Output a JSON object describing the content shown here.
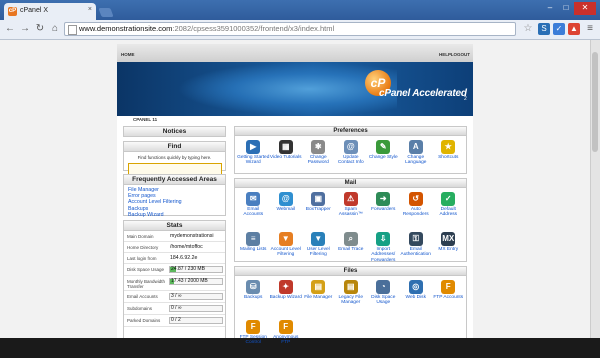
{
  "browser": {
    "tab_title": "cPanel X",
    "tab_favicon": "cP",
    "url_host": "www.demonstrationsite.com",
    "url_path": ":2082/cpsess3591000352/frontend/x3/index.html",
    "winbtn_min": "–",
    "winbtn_max": "□",
    "winbtn_close": "✕",
    "tab_close": "×"
  },
  "header": {
    "home": "HOME",
    "help": "HELP",
    "logout": "LOGOUT",
    "brand": "cPanel Accelerated",
    "brand_logo": "cP",
    "version": "2",
    "crumb": "CPANEL 11"
  },
  "notices": {
    "title": "Notices"
  },
  "find": {
    "title": "Find",
    "hint": "Find functions quickly by typing here."
  },
  "frequent": {
    "title": "Frequently Accessed Areas",
    "items": [
      "File Manager",
      "Error pages",
      "Account Level Filtering",
      "Backups",
      "Backup Wizard"
    ]
  },
  "stats": {
    "title": "Stats",
    "rows": [
      {
        "k": "Main Domain",
        "v": "mydemonstrationsi"
      },
      {
        "k": "Home Directory",
        "v": "/home/mtoffoc"
      },
      {
        "k": "Last login from",
        "v": "184.6.92.2e"
      }
    ],
    "bars": [
      {
        "k": "Disk Space Usage",
        "v": "24.87 / 230 MB",
        "pct": 10.8
      },
      {
        "k": "Monthly Bandwidth Transfer",
        "v": "17.43 / 2000 MB",
        "pct": 0.9
      },
      {
        "k": "Email Accounts",
        "v": "3 / ∞",
        "pct": 0
      },
      {
        "k": "Subdomains",
        "v": "0 / ∞",
        "pct": 0
      },
      {
        "k": "Parked Domains",
        "v": "0 / 2",
        "pct": 0
      }
    ]
  },
  "sections": [
    {
      "title": "Preferences",
      "items": [
        {
          "label": "Getting Started Wizard",
          "icon": "wizard-icon",
          "color": "#2c6fb5",
          "glyph": "▶"
        },
        {
          "label": "Video Tutorials",
          "icon": "film-icon",
          "color": "#333333",
          "glyph": "▦"
        },
        {
          "label": "Change Password",
          "icon": "password-icon",
          "color": "#8a8a8a",
          "glyph": "✱"
        },
        {
          "label": "Update Contact Info",
          "icon": "contact-icon",
          "color": "#6d8fb8",
          "glyph": "@"
        },
        {
          "label": "Change Style",
          "icon": "style-icon",
          "color": "#3a9a3a",
          "glyph": "✎"
        },
        {
          "label": "Change Language",
          "icon": "language-icon",
          "color": "#5a7fa8",
          "glyph": "A"
        },
        {
          "label": "Shortcuts",
          "icon": "star-icon",
          "color": "#e0b400",
          "glyph": "★"
        }
      ]
    },
    {
      "title": "Mail",
      "items": [
        {
          "label": "Email Accounts",
          "icon": "envelope-icon",
          "color": "#4a7fc0",
          "glyph": "✉"
        },
        {
          "label": "Webmail",
          "icon": "webmail-icon",
          "color": "#2f8fd0",
          "glyph": "@"
        },
        {
          "label": "BoxTrapper",
          "icon": "boxtrapper-icon",
          "color": "#4f6f9f",
          "glyph": "▣"
        },
        {
          "label": "Spam Assassin™",
          "icon": "spam-icon",
          "color": "#c0392b",
          "glyph": "⚠"
        },
        {
          "label": "Forwarders",
          "icon": "forwarders-icon",
          "color": "#2e8b57",
          "glyph": "➜"
        },
        {
          "label": "Auto Responders",
          "icon": "autoresponder-icon",
          "color": "#d35400",
          "glyph": "↺"
        },
        {
          "label": "Default Address",
          "icon": "default-address-icon",
          "color": "#27ae60",
          "glyph": "✓"
        },
        {
          "label": "Mailing Lists",
          "icon": "mailing-list-icon",
          "color": "#5d7fa3",
          "glyph": "≡"
        },
        {
          "label": "Account Level Filtering",
          "icon": "account-filter-icon",
          "color": "#e67e22",
          "glyph": "▼"
        },
        {
          "label": "User Level Filtering",
          "icon": "user-filter-icon",
          "color": "#2980b9",
          "glyph": "▼"
        },
        {
          "label": "Email Trace",
          "icon": "trace-icon",
          "color": "#7f8c8d",
          "glyph": "⌕"
        },
        {
          "label": "Import Addresses/ Forwarders",
          "icon": "import-icon",
          "color": "#16a085",
          "glyph": "⇩"
        },
        {
          "label": "Email Authentication",
          "icon": "authentication-icon",
          "color": "#34495e",
          "glyph": "⚿"
        },
        {
          "label": "MX Entry",
          "icon": "mx-entry-icon",
          "color": "#2c3e50",
          "glyph": "MX"
        }
      ]
    },
    {
      "title": "Files",
      "items": [
        {
          "label": "Backups",
          "icon": "backups-icon",
          "color": "#6a8caf",
          "glyph": "⛁"
        },
        {
          "label": "Backup Wizard",
          "icon": "backup-wizard-icon",
          "color": "#c0392b",
          "glyph": "✦"
        },
        {
          "label": "File Manager",
          "icon": "file-manager-icon",
          "color": "#d4a017",
          "glyph": "▤"
        },
        {
          "label": "Legacy File Manager",
          "icon": "legacy-file-manager-icon",
          "color": "#b8860b",
          "glyph": "▤"
        },
        {
          "label": "Disk Space Usage",
          "icon": "disk-usage-icon",
          "color": "#4a6f9a",
          "glyph": "◔"
        },
        {
          "label": "Web Disk",
          "icon": "web-disk-icon",
          "color": "#2f6fb0",
          "glyph": "◎"
        },
        {
          "label": "FTP Accounts",
          "icon": "ftp-accounts-icon",
          "color": "#e08a00",
          "glyph": "F"
        },
        {
          "label": "FTP Session Control",
          "icon": "ftp-session-icon",
          "color": "#e08a00",
          "glyph": "F"
        },
        {
          "label": "Anonymous FTP",
          "icon": "anonymous-ftp-icon",
          "color": "#e08a00",
          "glyph": "F"
        }
      ]
    }
  ]
}
